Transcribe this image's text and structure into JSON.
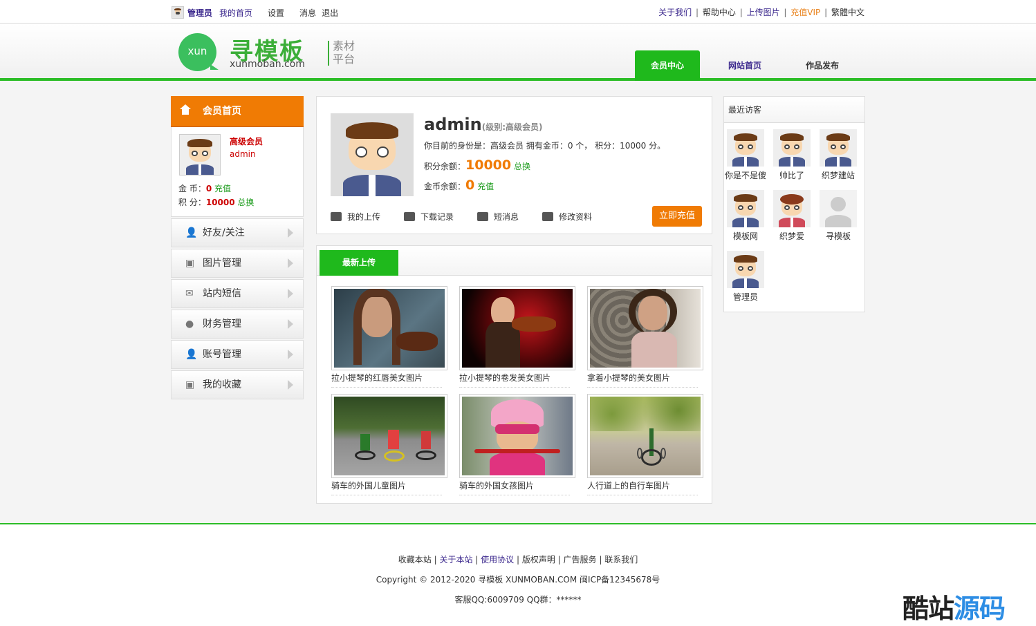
{
  "topbar": {
    "username": "管理员",
    "links_left": [
      "我的首页",
      "设置",
      "消息",
      "退出"
    ],
    "links_right": [
      "关于我们",
      "帮助中心",
      "上传图片",
      "充值VIP",
      "繁體中文"
    ]
  },
  "brand": {
    "circle_text": "xun",
    "name_cn": "寻模板",
    "domain": "xunmoban.com",
    "subtitle_line1": "素材",
    "subtitle_line2": "平台"
  },
  "nav": [
    "会员中心",
    "网站首页",
    "作品发布"
  ],
  "sidebar": {
    "head": "会员首页",
    "level": "高级会员",
    "name": "admin",
    "coin_label": "金 币：",
    "coin_value": "0",
    "coin_action": "充值",
    "points_label": "积 分：",
    "points_value": "10000",
    "points_action": "总换",
    "menu": [
      "好友/关注",
      "图片管理",
      "站内短信",
      "财务管理",
      "账号管理",
      "我的收藏"
    ]
  },
  "profile": {
    "name": "admin",
    "level_text": "(级别:高级会员)",
    "identity_text": "你目前的身份是：高级会员 拥有金币：0 个， 积分：10000 分。",
    "points_label": "积分余额：",
    "points_value": "10000",
    "points_action": "总换",
    "coin_label": "金币余额：",
    "coin_value": "0",
    "coin_action": "充值",
    "links": [
      "我的上传",
      "下载记录",
      "短消息",
      "修改资料"
    ],
    "recharge_button": "立即充值"
  },
  "uploads": {
    "tab": "最新上传",
    "items": [
      "拉小提琴的红唇美女图片",
      "拉小提琴的卷发美女图片",
      "拿着小提琴的美女图片",
      "骑车的外国儿童图片",
      "骑车的外国女孩图片",
      "人行道上的自行车图片"
    ]
  },
  "visitors": {
    "title": "最近访客",
    "names": [
      "你是不是傻",
      "帅比了",
      "织梦建站",
      "模板网",
      "织梦爱",
      "寻模板",
      "管理员"
    ]
  },
  "footer": {
    "links": [
      "收藏本站",
      "关于本站",
      "使用协议",
      "版权声明",
      "广告服务",
      "联系我们"
    ],
    "copyright": "Copyright © 2012-2020 寻模板 XUNMOBAN.COM 闽ICP备12345678号",
    "service": "客服QQ:6009709 QQ群：******"
  },
  "watermark": {
    "part1": "酷站",
    "part2": "源码"
  },
  "colors": {
    "green": "#1fb91c",
    "orange": "#f07b04",
    "purple": "#3d2a8e"
  }
}
